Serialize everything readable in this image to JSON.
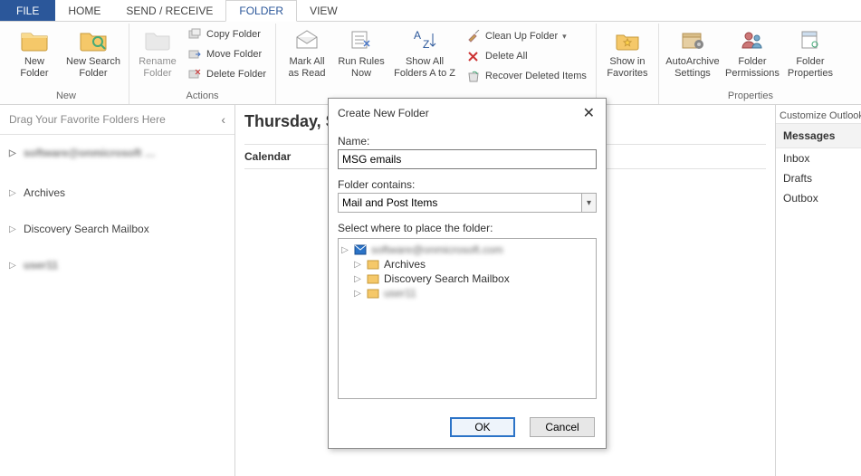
{
  "tabs": {
    "file": "FILE",
    "home": "HOME",
    "sendrecv": "SEND / RECEIVE",
    "folder": "FOLDER",
    "view": "VIEW"
  },
  "ribbon": {
    "new": {
      "label": "New",
      "new_folder": "New\nFolder",
      "new_search_folder": "New Search\nFolder"
    },
    "actions": {
      "label": "Actions",
      "rename": "Rename\nFolder",
      "copy": "Copy Folder",
      "move": "Move Folder",
      "delete": "Delete Folder"
    },
    "markall": "Mark All\nas Read",
    "runrules": "Run Rules\nNow",
    "showall": "Show All\nFolders A to Z",
    "cleanup_grp": {
      "cleanup": "Clean Up Folder",
      "deleteall": "Delete All",
      "recover": "Recover Deleted Items"
    },
    "fav": "Show in\nFavorites",
    "props": {
      "label": "Properties",
      "autoarchive": "AutoArchive\nSettings",
      "perms": "Folder\nPermissions",
      "fprops": "Folder\nProperties"
    }
  },
  "nav": {
    "fav_hint": "Drag Your Favorite Folders Here",
    "account_masked": "software@onmicrosoft …",
    "archives": "Archives",
    "discovery": "Discovery Search Mailbox",
    "user_masked": "user11"
  },
  "main": {
    "date": "Thursday, S",
    "calendar": "Calendar"
  },
  "right": {
    "customize": "Customize Outlook",
    "header": "Messages",
    "inbox": "Inbox",
    "drafts": "Drafts",
    "outbox": "Outbox"
  },
  "dialog": {
    "title": "Create New Folder",
    "name_lbl": "Name:",
    "name_val": "MSG emails",
    "contains_lbl": "Folder contains:",
    "contains_val": "Mail and Post Items",
    "place_lbl": "Select where to place the folder:",
    "tree": {
      "root_masked": "software@onmicrosoft.com",
      "archives": "Archives",
      "discovery": "Discovery Search Mailbox",
      "user_masked": "user11"
    },
    "ok": "OK",
    "cancel": "Cancel"
  }
}
